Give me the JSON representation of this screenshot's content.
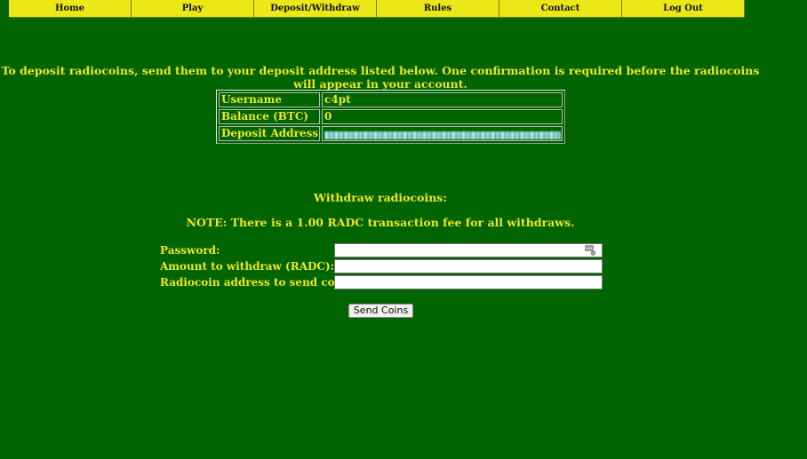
{
  "nav": {
    "items": [
      {
        "label": "Home"
      },
      {
        "label": "Play"
      },
      {
        "label": "Deposit/Withdraw"
      },
      {
        "label": "Rules"
      },
      {
        "label": "Contact"
      },
      {
        "label": "Log Out"
      }
    ]
  },
  "deposit": {
    "instructions": "To deposit radiocoins, send them to your deposit address listed below. One confirmation is required before the radiocoins will appear in your account.",
    "rows": [
      {
        "label": "Username",
        "value": "c4pt"
      },
      {
        "label": "Balance (BTC)",
        "value": "0"
      },
      {
        "label": "Deposit Address",
        "value": ""
      }
    ]
  },
  "withdraw": {
    "title": "Withdraw radiocoins:",
    "note": "NOTE: There is a 1.00 RADC transaction fee for all withdraws.",
    "fields": [
      {
        "label": "Password:",
        "value": ""
      },
      {
        "label": "Amount to withdraw (RADC):",
        "value": ""
      },
      {
        "label": "Radiocoin address to send coins to:",
        "value": ""
      }
    ],
    "submit_label": "Send Coins"
  },
  "colors": {
    "background": "#006400",
    "nav_bg": "#ece717",
    "text": "#f0e626"
  },
  "icons": {
    "password_field": "password-manager-key-icon"
  }
}
